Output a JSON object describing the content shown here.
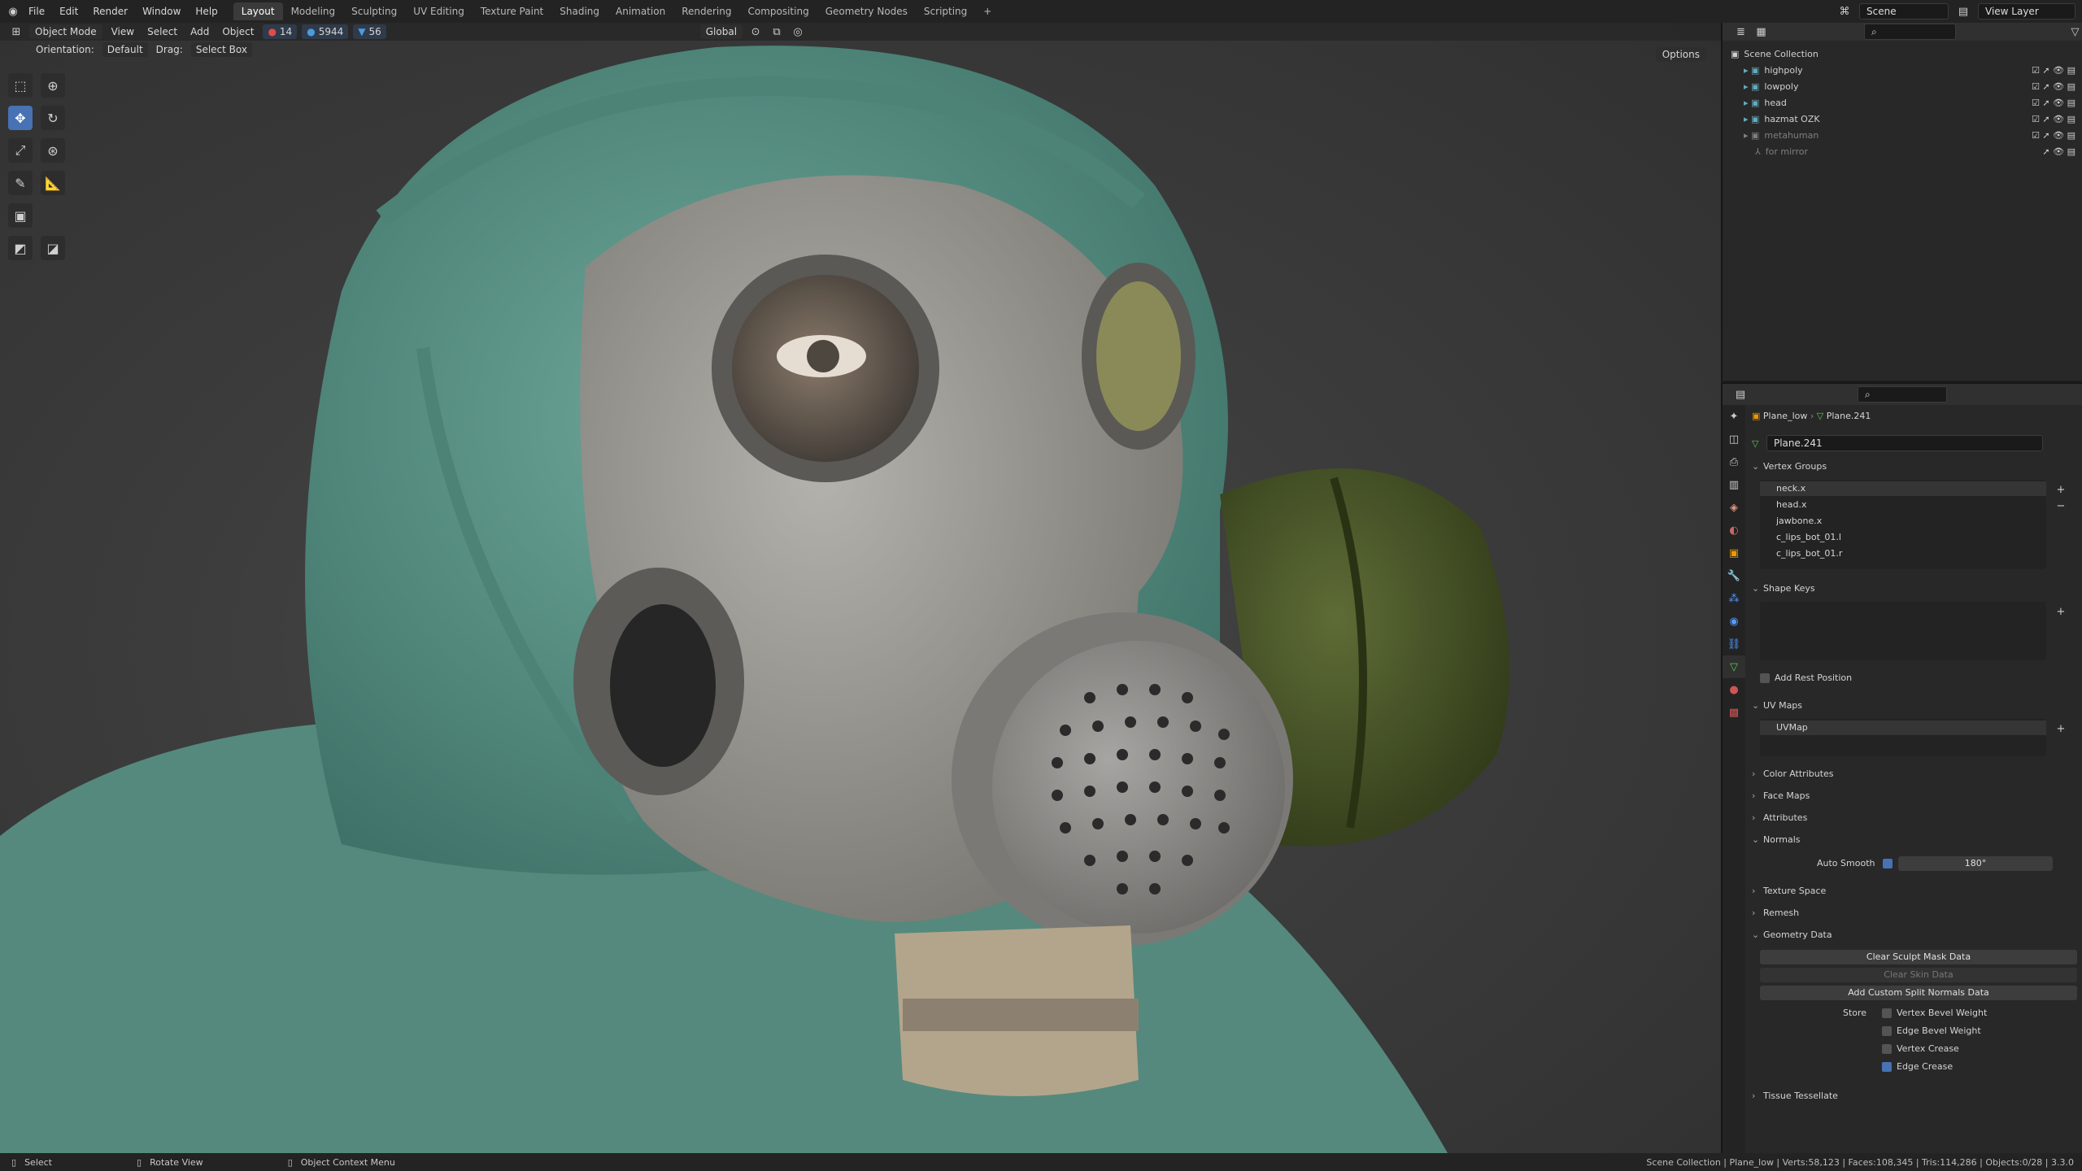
{
  "menu": [
    "File",
    "Edit",
    "Render",
    "Window",
    "Help"
  ],
  "workspaces": [
    "Layout",
    "Modeling",
    "Sculpting",
    "UV Editing",
    "Texture Paint",
    "Shading",
    "Animation",
    "Rendering",
    "Compositing",
    "Geometry Nodes",
    "Scripting"
  ],
  "scene_name": "Scene",
  "view_layer": "View Layer",
  "viewport": {
    "mode": "Object Mode",
    "view": "View",
    "select": "Select",
    "add": "Add",
    "object": "Object",
    "stats": [
      "14",
      "5944",
      "56"
    ],
    "transform": "Global",
    "orientation_label": "Orientation:",
    "orientation": "Default",
    "drag_label": "Drag:",
    "drag": "Select Box",
    "options": "Options"
  },
  "outliner": {
    "root": "Scene Collection",
    "items": [
      {
        "name": "highpoly",
        "dim": false
      },
      {
        "name": "lowpoly",
        "dim": false
      },
      {
        "name": "head",
        "dim": false
      },
      {
        "name": "hazmat OZK",
        "dim": false
      },
      {
        "name": "metahuman",
        "dim": true
      },
      {
        "name": "for mirror",
        "dim": true
      }
    ]
  },
  "props": {
    "object": "Plane_low",
    "mesh": "Plane.241",
    "datablock": "Plane.241",
    "vertex_groups_title": "Vertex Groups",
    "vertex_groups": [
      "neck.x",
      "head.x",
      "jawbone.x",
      "c_lips_bot_01.l",
      "c_lips_bot_01.r"
    ],
    "shape_keys_title": "Shape Keys",
    "add_rest_position": "Add Rest Position",
    "uv_maps_title": "UV Maps",
    "uv_map": "UVMap",
    "color_attributes": "Color Attributes",
    "face_maps": "Face Maps",
    "attributes": "Attributes",
    "normals": "Normals",
    "auto_smooth": "Auto Smooth",
    "auto_smooth_angle": "180°",
    "texture_space": "Texture Space",
    "remesh": "Remesh",
    "geometry_data": "Geometry Data",
    "clear_sculpt": "Clear Sculpt Mask Data",
    "clear_skin": "Clear Skin Data",
    "add_custom_normals": "Add Custom Split Normals Data",
    "store": "Store",
    "store_items": [
      {
        "label": "Vertex Bevel Weight",
        "on": false
      },
      {
        "label": "Edge Bevel Weight",
        "on": false
      },
      {
        "label": "Vertex Crease",
        "on": false
      },
      {
        "label": "Edge Crease",
        "on": true
      }
    ],
    "tissue": "Tissue Tessellate"
  },
  "status": {
    "select": "Select",
    "rotate": "Rotate View",
    "context": "Object Context Menu",
    "info": "Scene Collection | Plane_low | Verts:58,123 | Faces:108,345 | Tris:114,286 | Objects:0/28 | 3.3.0"
  },
  "colors": {
    "accent": "#4772b3",
    "hood": "#5e9a8c",
    "mask": "#9c9a95",
    "canister": "#4b5a2a"
  }
}
